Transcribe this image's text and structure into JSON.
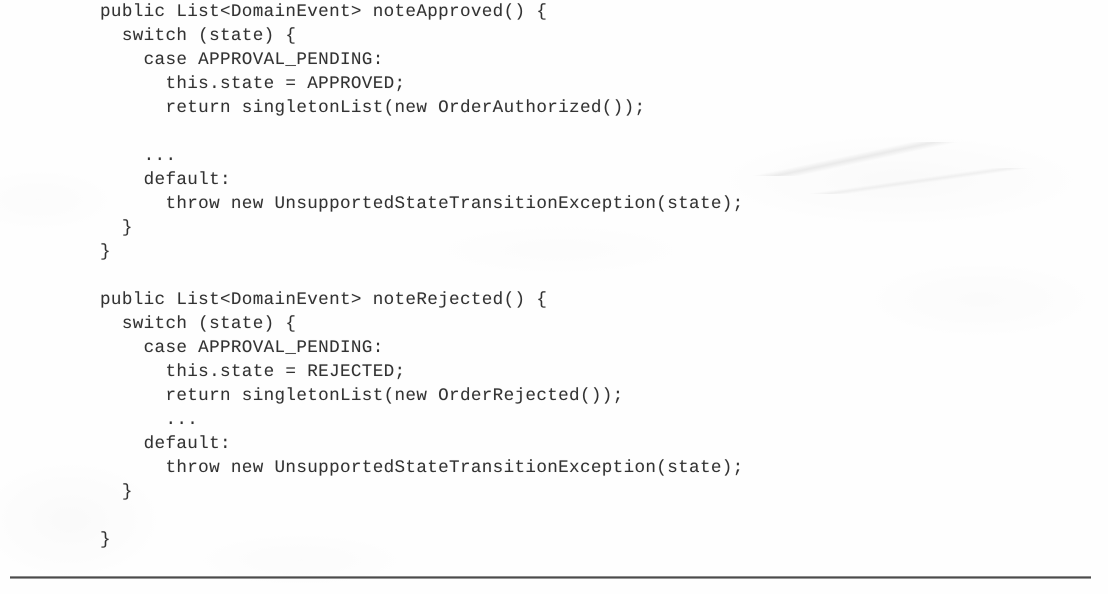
{
  "document": {
    "kind": "scanned-book-page",
    "language": "Java",
    "background_color": "#fefefe",
    "text_color": "#2b2b2b",
    "rule_color": "#3c3c3c"
  },
  "code_listing": {
    "lines": [
      "public List<DomainEvent> noteApproved() {",
      "  switch (state) {",
      "    case APPROVAL_PENDING:",
      "      this.state = APPROVED;",
      "      return singletonList(new OrderAuthorized());",
      "",
      "    ...",
      "    default:",
      "      throw new UnsupportedStateTransitionException(state);",
      "  }",
      "}",
      "",
      "public List<DomainEvent> noteRejected() {",
      "  switch (state) {",
      "    case APPROVAL_PENDING:",
      "      this.state = REJECTED;",
      "      return singletonList(new OrderRejected());",
      "      ...",
      "    default:",
      "      throw new UnsupportedStateTransitionException(state);",
      "  }",
      "",
      "}"
    ]
  },
  "bottom_rule": {
    "label": "horizontal-rule"
  }
}
